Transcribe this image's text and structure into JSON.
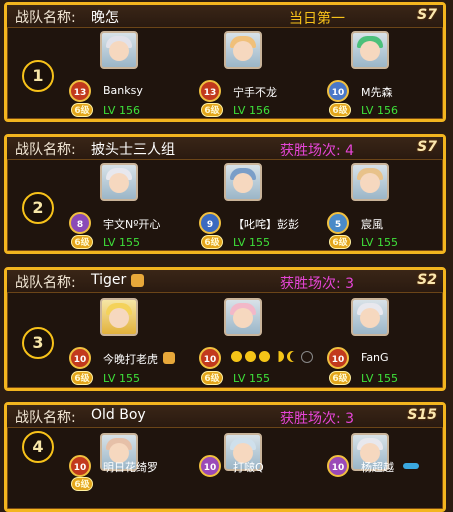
{
  "label": "战队名称:",
  "teams": [
    {
      "rank": "1",
      "name": "晚怎",
      "stat": "当日第一",
      "season": "S7",
      "members": [
        {
          "name": "Banksy",
          "badge": "13",
          "lv": "LV 156",
          "vip": "6级"
        },
        {
          "name": "宁手不龙",
          "badge": "13",
          "lv": "LV 156",
          "vip": "6级"
        },
        {
          "name": "M先森",
          "badge": "10",
          "lv": "LV 156",
          "vip": "6级"
        }
      ]
    },
    {
      "rank": "2",
      "name": "披头士三人组",
      "stat": "获胜场次: 4",
      "season": "S7",
      "members": [
        {
          "name": "宇文Nº开心",
          "badge": "8",
          "lv": "LV 155",
          "vip": "6级"
        },
        {
          "name": "【叱咤】彭彭",
          "badge": "9",
          "lv": "LV 155",
          "vip": "6级"
        },
        {
          "name": "宸風",
          "badge": "5",
          "lv": "LV 155",
          "vip": "6级"
        }
      ]
    },
    {
      "rank": "3",
      "name": "Tiger",
      "stat": "获胜场次: 3",
      "season": "S2",
      "members": [
        {
          "name": "今晚打老虎",
          "badge": "10",
          "lv": "LV 155",
          "vip": "6级"
        },
        {
          "name": "",
          "badge": "10",
          "lv": "LV 155",
          "vip": "6级"
        },
        {
          "name": "FanG",
          "badge": "10",
          "lv": "LV 155",
          "vip": "6级"
        }
      ]
    },
    {
      "rank": "4",
      "name": "Old Boy",
      "stat": "获胜场次: 3",
      "season": "S15",
      "members": [
        {
          "name": "明日花绮罗",
          "badge": "10",
          "lv": "",
          "vip": "6级"
        },
        {
          "name": "打啵Q",
          "badge": "10",
          "lv": "",
          "vip": ""
        },
        {
          "name": "杨超越",
          "badge": "10",
          "lv": "",
          "vip": ""
        }
      ]
    }
  ]
}
